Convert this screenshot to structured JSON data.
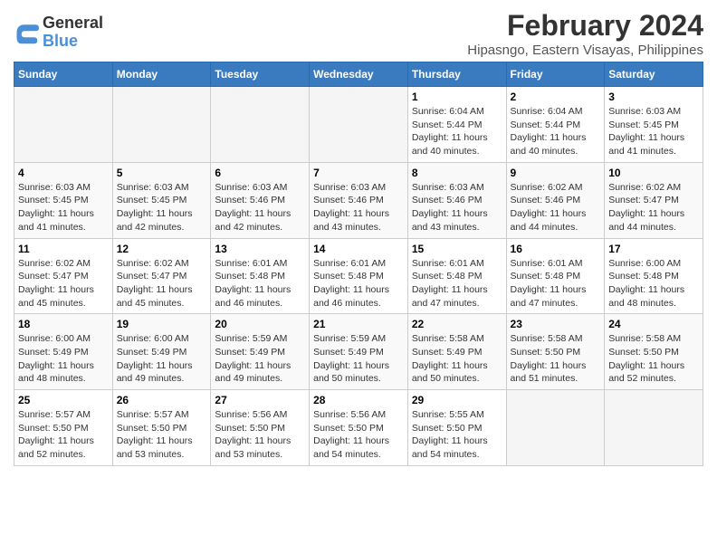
{
  "app": {
    "logo_line1": "General",
    "logo_line2": "Blue"
  },
  "calendar": {
    "title": "February 2024",
    "subtitle": "Hipasngo, Eastern Visayas, Philippines",
    "days_of_week": [
      "Sunday",
      "Monday",
      "Tuesday",
      "Wednesday",
      "Thursday",
      "Friday",
      "Saturday"
    ],
    "weeks": [
      [
        {
          "day": "",
          "info": "",
          "empty": true
        },
        {
          "day": "",
          "info": "",
          "empty": true
        },
        {
          "day": "",
          "info": "",
          "empty": true
        },
        {
          "day": "",
          "info": "",
          "empty": true
        },
        {
          "day": "1",
          "info": "Sunrise: 6:04 AM\nSunset: 5:44 PM\nDaylight: 11 hours\nand 40 minutes.",
          "empty": false
        },
        {
          "day": "2",
          "info": "Sunrise: 6:04 AM\nSunset: 5:44 PM\nDaylight: 11 hours\nand 40 minutes.",
          "empty": false
        },
        {
          "day": "3",
          "info": "Sunrise: 6:03 AM\nSunset: 5:45 PM\nDaylight: 11 hours\nand 41 minutes.",
          "empty": false
        }
      ],
      [
        {
          "day": "4",
          "info": "Sunrise: 6:03 AM\nSunset: 5:45 PM\nDaylight: 11 hours\nand 41 minutes.",
          "empty": false
        },
        {
          "day": "5",
          "info": "Sunrise: 6:03 AM\nSunset: 5:45 PM\nDaylight: 11 hours\nand 42 minutes.",
          "empty": false
        },
        {
          "day": "6",
          "info": "Sunrise: 6:03 AM\nSunset: 5:46 PM\nDaylight: 11 hours\nand 42 minutes.",
          "empty": false
        },
        {
          "day": "7",
          "info": "Sunrise: 6:03 AM\nSunset: 5:46 PM\nDaylight: 11 hours\nand 43 minutes.",
          "empty": false
        },
        {
          "day": "8",
          "info": "Sunrise: 6:03 AM\nSunset: 5:46 PM\nDaylight: 11 hours\nand 43 minutes.",
          "empty": false
        },
        {
          "day": "9",
          "info": "Sunrise: 6:02 AM\nSunset: 5:46 PM\nDaylight: 11 hours\nand 44 minutes.",
          "empty": false
        },
        {
          "day": "10",
          "info": "Sunrise: 6:02 AM\nSunset: 5:47 PM\nDaylight: 11 hours\nand 44 minutes.",
          "empty": false
        }
      ],
      [
        {
          "day": "11",
          "info": "Sunrise: 6:02 AM\nSunset: 5:47 PM\nDaylight: 11 hours\nand 45 minutes.",
          "empty": false
        },
        {
          "day": "12",
          "info": "Sunrise: 6:02 AM\nSunset: 5:47 PM\nDaylight: 11 hours\nand 45 minutes.",
          "empty": false
        },
        {
          "day": "13",
          "info": "Sunrise: 6:01 AM\nSunset: 5:48 PM\nDaylight: 11 hours\nand 46 minutes.",
          "empty": false
        },
        {
          "day": "14",
          "info": "Sunrise: 6:01 AM\nSunset: 5:48 PM\nDaylight: 11 hours\nand 46 minutes.",
          "empty": false
        },
        {
          "day": "15",
          "info": "Sunrise: 6:01 AM\nSunset: 5:48 PM\nDaylight: 11 hours\nand 47 minutes.",
          "empty": false
        },
        {
          "day": "16",
          "info": "Sunrise: 6:01 AM\nSunset: 5:48 PM\nDaylight: 11 hours\nand 47 minutes.",
          "empty": false
        },
        {
          "day": "17",
          "info": "Sunrise: 6:00 AM\nSunset: 5:48 PM\nDaylight: 11 hours\nand 48 minutes.",
          "empty": false
        }
      ],
      [
        {
          "day": "18",
          "info": "Sunrise: 6:00 AM\nSunset: 5:49 PM\nDaylight: 11 hours\nand 48 minutes.",
          "empty": false
        },
        {
          "day": "19",
          "info": "Sunrise: 6:00 AM\nSunset: 5:49 PM\nDaylight: 11 hours\nand 49 minutes.",
          "empty": false
        },
        {
          "day": "20",
          "info": "Sunrise: 5:59 AM\nSunset: 5:49 PM\nDaylight: 11 hours\nand 49 minutes.",
          "empty": false
        },
        {
          "day": "21",
          "info": "Sunrise: 5:59 AM\nSunset: 5:49 PM\nDaylight: 11 hours\nand 50 minutes.",
          "empty": false
        },
        {
          "day": "22",
          "info": "Sunrise: 5:58 AM\nSunset: 5:49 PM\nDaylight: 11 hours\nand 50 minutes.",
          "empty": false
        },
        {
          "day": "23",
          "info": "Sunrise: 5:58 AM\nSunset: 5:50 PM\nDaylight: 11 hours\nand 51 minutes.",
          "empty": false
        },
        {
          "day": "24",
          "info": "Sunrise: 5:58 AM\nSunset: 5:50 PM\nDaylight: 11 hours\nand 52 minutes.",
          "empty": false
        }
      ],
      [
        {
          "day": "25",
          "info": "Sunrise: 5:57 AM\nSunset: 5:50 PM\nDaylight: 11 hours\nand 52 minutes.",
          "empty": false
        },
        {
          "day": "26",
          "info": "Sunrise: 5:57 AM\nSunset: 5:50 PM\nDaylight: 11 hours\nand 53 minutes.",
          "empty": false
        },
        {
          "day": "27",
          "info": "Sunrise: 5:56 AM\nSunset: 5:50 PM\nDaylight: 11 hours\nand 53 minutes.",
          "empty": false
        },
        {
          "day": "28",
          "info": "Sunrise: 5:56 AM\nSunset: 5:50 PM\nDaylight: 11 hours\nand 54 minutes.",
          "empty": false
        },
        {
          "day": "29",
          "info": "Sunrise: 5:55 AM\nSunset: 5:50 PM\nDaylight: 11 hours\nand 54 minutes.",
          "empty": false
        },
        {
          "day": "",
          "info": "",
          "empty": true
        },
        {
          "day": "",
          "info": "",
          "empty": true
        }
      ]
    ]
  }
}
